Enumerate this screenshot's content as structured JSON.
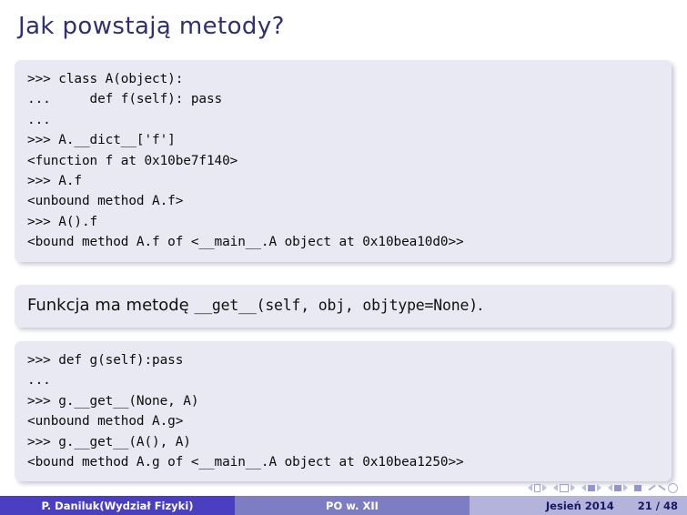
{
  "slide": {
    "title": "Jak powstają metody?",
    "code_block_1": {
      "lines": [
        ">>> class A(object):",
        "...     def f(self): pass",
        "...",
        ">>> A.__dict__['f']",
        "<function f at 0x10be7f140>",
        ">>> A.f",
        "<unbound method A.f>",
        ">>> A().f",
        "<bound method A.f of <__main__.A object at 0x10bea10d0>>"
      ]
    },
    "text_block": {
      "prefix": "Funkcja ma metodę ",
      "mono": "__get__(self, obj, objtype=None)",
      "suffix": "."
    },
    "code_block_2": {
      "lines": [
        ">>> def g(self):pass",
        "...",
        ">>> g.__get__(None, A)",
        "<unbound method A.g>",
        ">>> g.__get__(A(), A)",
        "<bound method A.g of <__main__.A object at 0x10bea1250>>"
      ]
    }
  },
  "footer": {
    "author": "P. Daniluk(Wydział Fizyki)",
    "subject": "PO w. XII",
    "date": "Jesień 2014",
    "page": "21 / 48"
  },
  "colors": {
    "title": "#2f2f72",
    "block_bg": "#e9e9f4",
    "footer_author_bg": "#4a3fc0",
    "footer_subject_bg": "#7d7dc4",
    "footer_meta_bg": "#b3b3dc",
    "nav_symbol": "#9a9ad0"
  }
}
